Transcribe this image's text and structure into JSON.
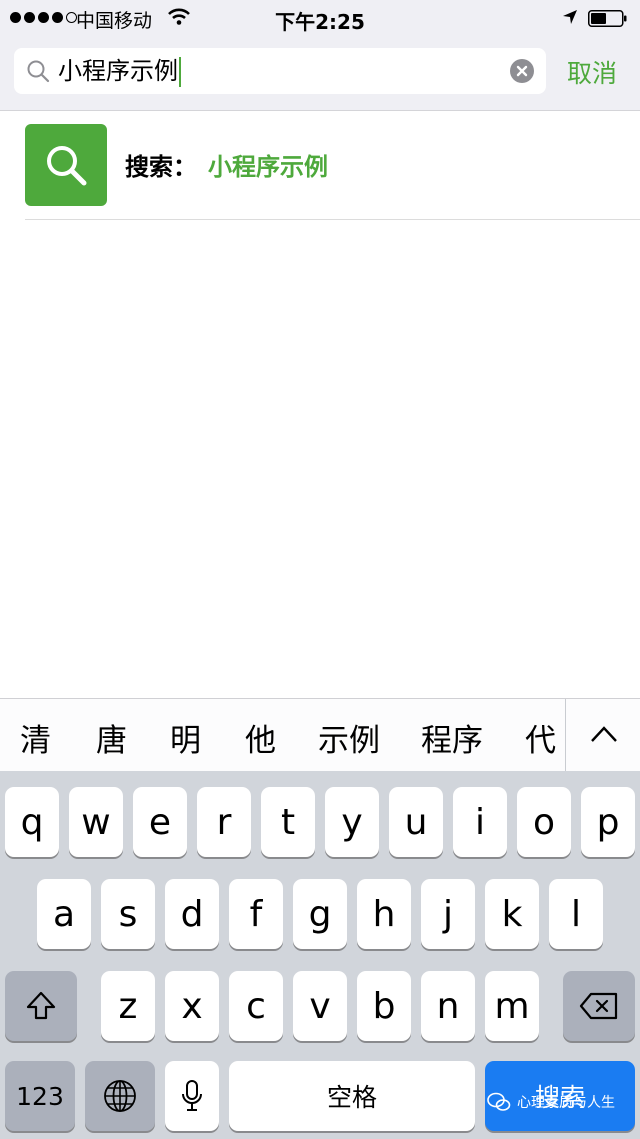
{
  "status_bar": {
    "carrier": "中国移动",
    "time": "下午2:25"
  },
  "search": {
    "query": "小程序示例",
    "cancel_label": "取消"
  },
  "result": {
    "label": "搜索：",
    "query": "小程序示例"
  },
  "candidates": [
    "清",
    "唐",
    "明",
    "他",
    "示例",
    "程序",
    "代码"
  ],
  "keyboard": {
    "row1": [
      "q",
      "w",
      "e",
      "r",
      "t",
      "y",
      "u",
      "i",
      "o",
      "p"
    ],
    "row2": [
      "a",
      "s",
      "d",
      "f",
      "g",
      "h",
      "j",
      "k",
      "l"
    ],
    "row3": [
      "z",
      "x",
      "c",
      "v",
      "b",
      "n",
      "m"
    ],
    "numbers_label": "123",
    "space_label": "空格",
    "search_label": "搜索"
  },
  "watermark": "心理素质与人生",
  "colors": {
    "accent_green": "#4ea93c",
    "search_key_blue": "#1a7cf2"
  }
}
